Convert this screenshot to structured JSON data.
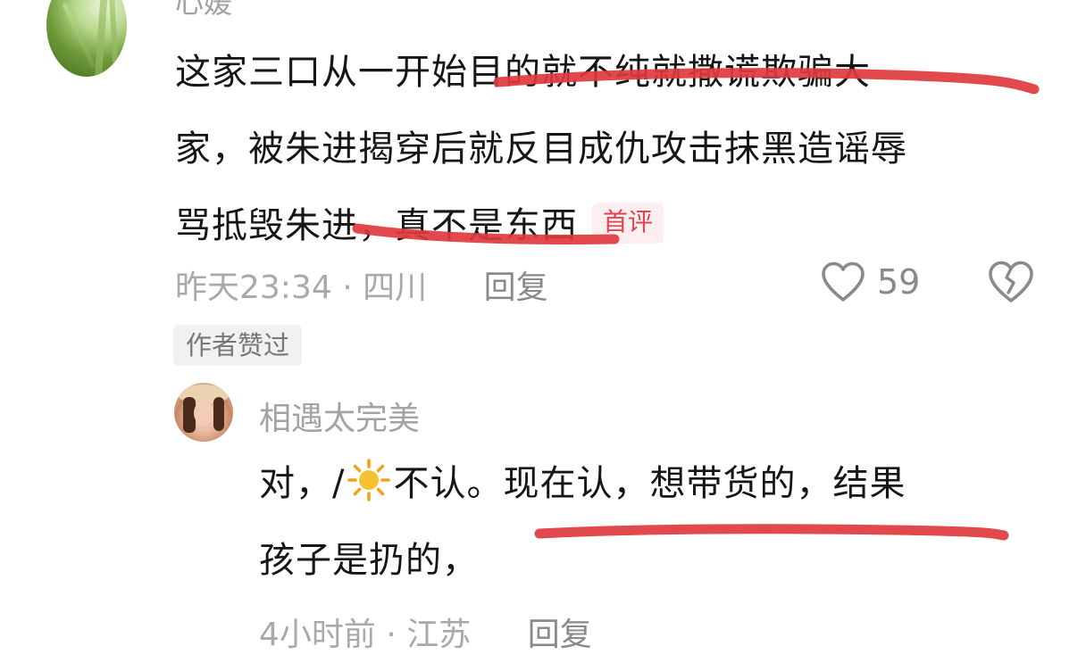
{
  "top_comment": {
    "username": "心媛",
    "text_lines": [
      "这家三口从一开始目的就不纯就撒谎欺骗大",
      "家，被朱进揭穿后就反目成仇攻击抹黑造谣辱",
      "骂抵毁朱进，真不是东西"
    ],
    "badge": "首评",
    "time": "昨天23:34",
    "separator": "·",
    "location": "四川",
    "reply_label": "回复",
    "like_count": "59",
    "author_liked": "作者赞过"
  },
  "reply_comment": {
    "username": "相遇太完美",
    "text_line1_before": "对，/",
    "text_line1_after": "不认。现在认，想带货的，结果",
    "text_line2": "孩子是扔的，",
    "time": "4小时前",
    "separator": "·",
    "location": "江苏",
    "reply_label": "回复"
  },
  "colors": {
    "underline": "#e0393e",
    "badge_text": "#e0454e",
    "meta_text": "#a9a9a9"
  },
  "icons": {
    "like": "heart-outline-icon",
    "dislike": "broken-heart-icon",
    "sun": "sun-emoji-icon"
  }
}
